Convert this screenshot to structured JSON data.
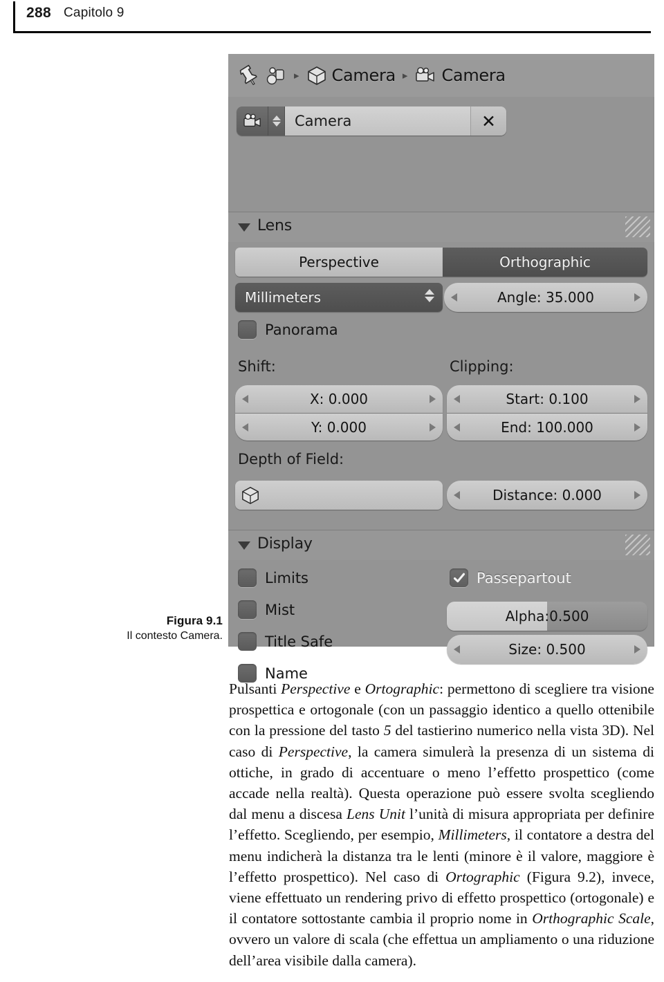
{
  "running_head": {
    "page_number": "288",
    "chapter": "Capitolo 9"
  },
  "figure": {
    "caption_title": "Figura 9.1",
    "caption_text": "Il contesto Camera."
  },
  "blender_panel": {
    "breadcrumb": {
      "pin_icon": "pin-icon",
      "object_data_icon": "object-data-icon",
      "object_icon": "cube-icon",
      "object_label": "Camera",
      "data_icon": "camera-data-icon",
      "data_label": "Camera",
      "separator": "▸"
    },
    "datablock": {
      "icon": "camera-data-icon",
      "updown_icon": "up-down-arrows-icon",
      "name_value": "Camera",
      "clear_label": "✕"
    },
    "lens_section": {
      "title": "Lens",
      "collapse_icon": "triangle-down-icon",
      "grip_icon": "resize-grip-icon",
      "type_buttons": [
        {
          "label": "Perspective",
          "active": false
        },
        {
          "label": "Orthographic",
          "active": true
        }
      ],
      "unit_dropdown": {
        "label": "Millimeters",
        "arrows_icon": "dropdown-arrows-icon"
      },
      "angle_field": {
        "label": "Angle: 35.000",
        "left_icon": "chevron-left-icon",
        "right_icon": "chevron-right-icon"
      },
      "panorama_checkbox": {
        "label": "Panorama",
        "checked": false
      },
      "shift_group_label": "Shift:",
      "shift_fields": [
        {
          "label": "X: 0.000"
        },
        {
          "label": "Y: 0.000"
        }
      ],
      "clipping_group_label": "Clipping:",
      "clipping_fields": [
        {
          "label": "Start: 0.100"
        },
        {
          "label": "End: 100.000"
        }
      ],
      "dof_group_label": "Depth of Field:",
      "dof_object_field": {
        "icon": "cube-icon",
        "value": ""
      },
      "dof_distance_field": {
        "label": "Distance: 0.000"
      }
    },
    "display_section": {
      "title": "Display",
      "collapse_icon": "triangle-down-icon",
      "grip_icon": "resize-grip-icon",
      "checkboxes_left": [
        {
          "label": "Limits",
          "checked": false
        },
        {
          "label": "Mist",
          "checked": false
        },
        {
          "label": "Title Safe",
          "checked": false
        },
        {
          "label": "Name",
          "checked": false
        }
      ],
      "passepartout_checkbox": {
        "label": "Passepartout",
        "checked": true,
        "check_icon": "check-icon"
      },
      "alpha_slider": {
        "label": "Alpha:0.500",
        "fill_percent": 50
      },
      "size_field": {
        "label": "Size: 0.500"
      }
    },
    "colors": {
      "panel_bg": "#949494",
      "header_bg": "#9a9a9a",
      "widget_light": "#cfcfcf",
      "widget_dark": "#5d5d5d",
      "text": "#1b1b1b"
    }
  },
  "body_text": {
    "paragraph_html": "Pulsanti <i>Perspective</i> e <i>Ortographic</i>: permettono di scegliere tra visione prospettica e ortogonale (con un passaggio identico a quello ottenibile con la pressione del tasto <i>5</i> del tastierino numerico nella vista 3D). Nel caso di <i>Perspective</i>, la camera simulerà la presenza di un sistema di ottiche, in grado di accentuare o meno l’effetto prospettico (come accade nella realtà). Questa operazione può essere svolta scegliendo dal menu a discesa <i>Lens Unit</i> l’unità di misura appropriata per definire l’effetto. Scegliendo, per esempio, <i>Millimeters</i>, il contatore a destra del menu indicherà la distanza tra le lenti (minore è il valore, maggiore è l’effetto prospettico). Nel caso di <i>Ortographic</i> (Figura 9.2), invece, viene effettuato un rendering privo di effetto prospettico (ortogonale) e il contatore sottostante cambia il proprio nome in <i>Orthographic Scale</i>, ovvero un valore di scala (che effettua un ampliamento o una riduzione dell’area visibile dalla camera)."
  }
}
